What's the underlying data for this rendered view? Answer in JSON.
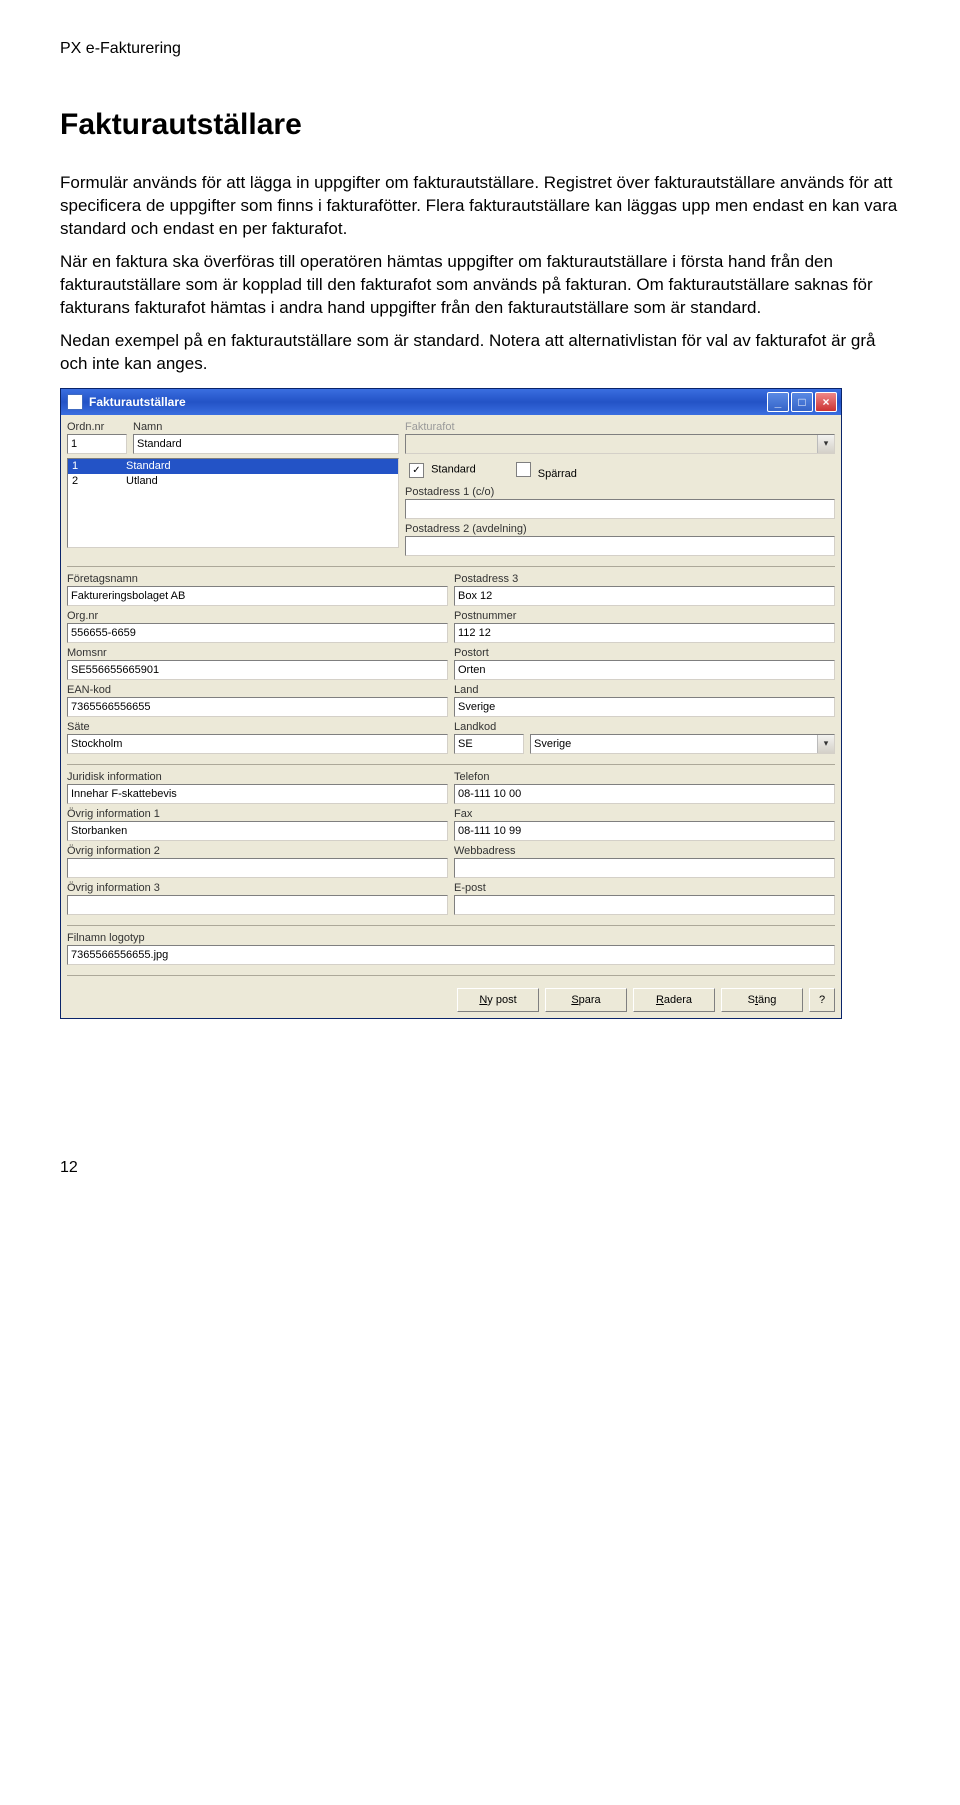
{
  "doc_header": "PX e-Fakturering",
  "page_title": "Fakturautställare",
  "paragraphs": {
    "p1": "Formulär används för att lägga in uppgifter om fakturautställare. Registret över fakturautställare används för att specificera de uppgifter som finns i fakturafötter. Flera fakturautställare kan läggas upp men endast en kan vara standard och endast en per fakturafot.",
    "p2": "När en faktura ska överföras till operatören hämtas uppgifter om fakturautställare i första hand från den fakturautställare som är kopplad till den fakturafot som används på fakturan. Om fakturautställare saknas för fakturans fakturafot hämtas i andra hand uppgifter från den fakturautställare som är standard.",
    "p3": "Nedan exempel på en fakturautställare som är standard. Notera att alternativlistan för val av fakturafot är grå och inte kan anges."
  },
  "window": {
    "title": "Fakturautställare",
    "left_labels": {
      "ordn": "Ordn.nr",
      "namn": "Namn"
    },
    "ordn_value": "1",
    "namn_value": "Standard",
    "list_items": [
      {
        "ordn": "1",
        "namn": "Standard",
        "selected": true
      },
      {
        "ordn": "2",
        "namn": "Utland",
        "selected": false
      }
    ],
    "right_top": {
      "fakturafot_label": "Fakturafot",
      "fakturafot_value": "",
      "standard_label": "Standard",
      "standard_checked": true,
      "sparrad_label": "Spärrad",
      "sparrad_checked": false,
      "postadress1_label": "Postadress 1 (c/o)",
      "postadress1_value": "",
      "postadress2_label": "Postadress 2 (avdelning)",
      "postadress2_value": ""
    },
    "mid_left": {
      "foretag_label": "Företagsnamn",
      "foretag_value": "Faktureringsbolaget AB",
      "orgnr_label": "Org.nr",
      "orgnr_value": "556655-6659",
      "momsnr_label": "Momsnr",
      "momsnr_value": "SE556655665901",
      "ean_label": "EAN-kod",
      "ean_value": "7365566556655",
      "sate_label": "Säte",
      "sate_value": "Stockholm"
    },
    "mid_right": {
      "postadress3_label": "Postadress 3",
      "postadress3_value": "Box 12",
      "postnr_label": "Postnummer",
      "postnr_value": "112 12",
      "postort_label": "Postort",
      "postort_value": "Orten",
      "land_label": "Land",
      "land_value": "Sverige",
      "landkod_label": "Landkod",
      "landkod_code": "SE",
      "landkod_name": "Sverige"
    },
    "lower_left": {
      "juridisk_label": "Juridisk information",
      "juridisk_value": "Innehar F-skattebevis",
      "ovrig1_label": "Övrig information 1",
      "ovrig1_value": "Storbanken",
      "ovrig2_label": "Övrig information 2",
      "ovrig2_value": "",
      "ovrig3_label": "Övrig information 3",
      "ovrig3_value": ""
    },
    "lower_right": {
      "telefon_label": "Telefon",
      "telefon_value": "08-111 10 00",
      "fax_label": "Fax",
      "fax_value": "08-111 10 99",
      "webb_label": "Webbadress",
      "webb_value": "",
      "epost_label": "E-post",
      "epost_value": ""
    },
    "bottom": {
      "filnamn_label": "Filnamn logotyp",
      "filnamn_value": "7365566556655.jpg"
    },
    "buttons": {
      "ny": "Ny post",
      "spara": "Spara",
      "radera": "Radera",
      "stang": "Stäng",
      "help": "?"
    }
  },
  "page_number": "12"
}
